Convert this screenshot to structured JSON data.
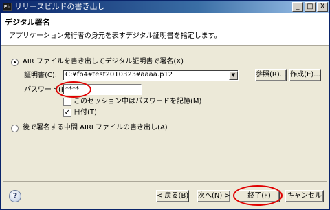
{
  "window": {
    "title": "リリースビルドの書き出し",
    "app_icon_label": "Fb",
    "minimize": "_",
    "maximize": "□",
    "close": "X"
  },
  "header": {
    "title": "デジタル署名",
    "description": "アプリケーション発行者の身元を表すデジタル証明書を指定します。"
  },
  "sign_option": {
    "label": "AIR ファイルを書き出してデジタル証明書で署名(X)",
    "selected": true
  },
  "certificate": {
    "label": "証明書(C):",
    "value": "C:¥fb4¥test2010323¥aaaa.p12",
    "browse_button": "参照(R)...",
    "create_button": "作成(E)..."
  },
  "password": {
    "label": "パスワード(P):",
    "value": "****"
  },
  "remember_password": {
    "label": "このセッション中はパスワードを記憶(M)",
    "checked": false
  },
  "timestamp": {
    "label": "日付(T)",
    "checked": true
  },
  "later_option": {
    "label": "後で署名する中間 AIRI ファイルの書き出し(A)",
    "selected": false
  },
  "footer": {
    "help_icon": "?",
    "back_button": "< 戻る(B)",
    "next_button": "次へ(N) >",
    "finish_button": "終了(F)",
    "cancel_button": "キャンセル"
  }
}
